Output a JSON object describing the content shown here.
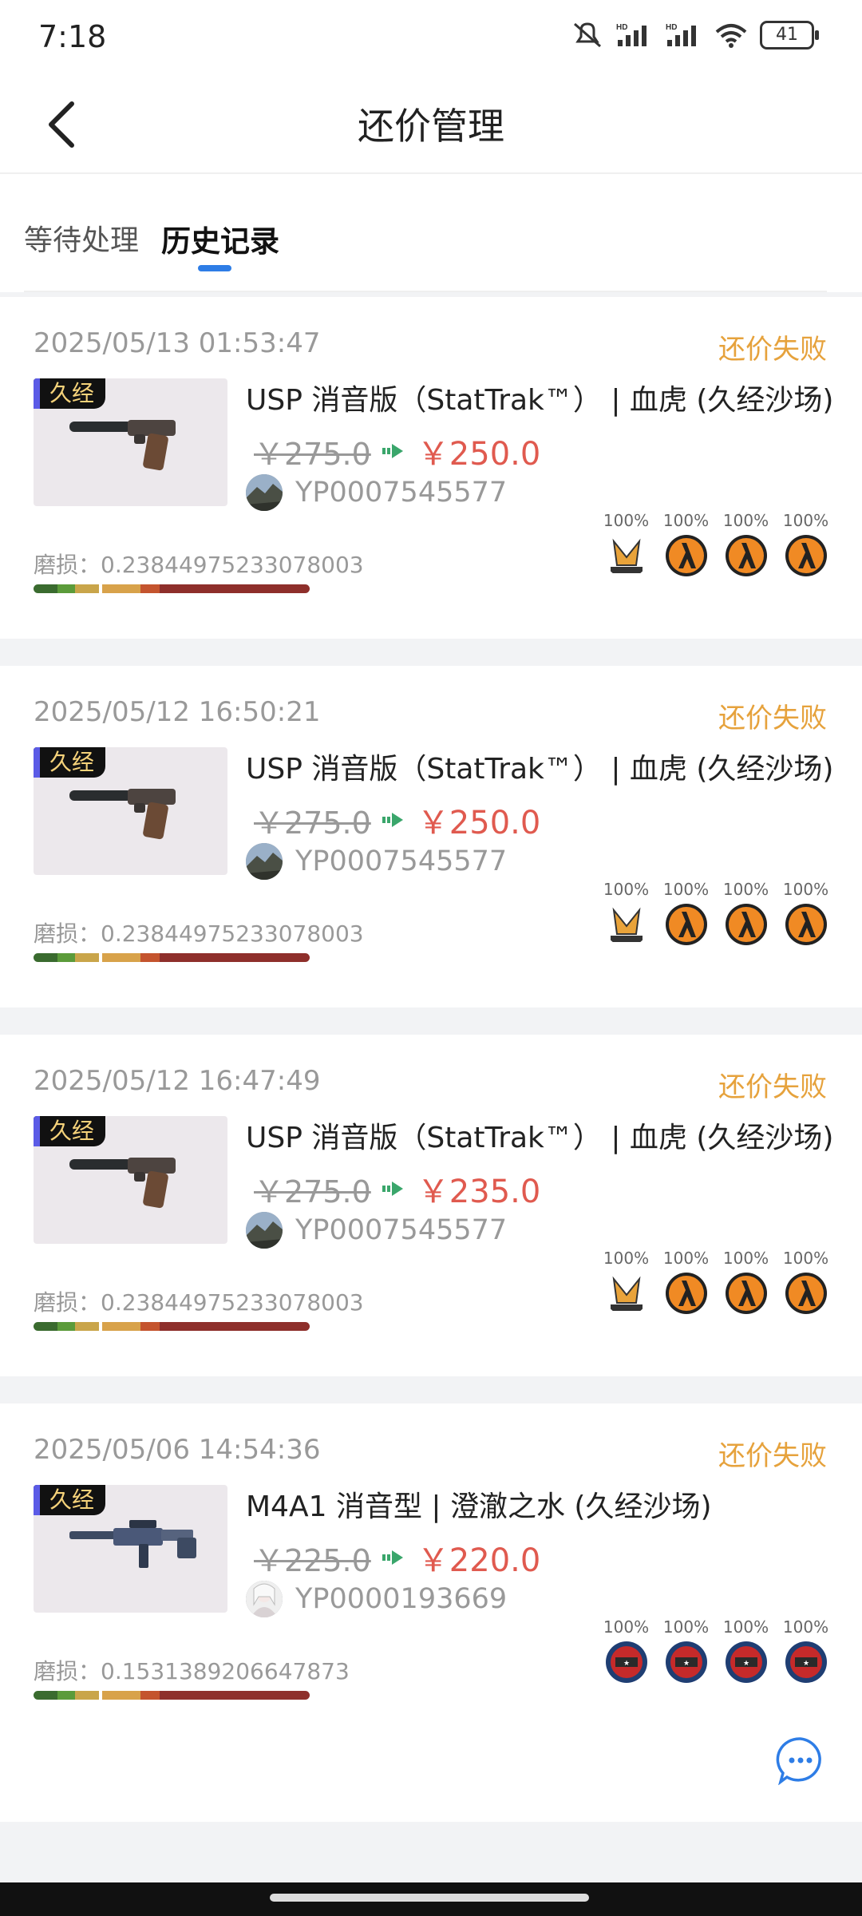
{
  "status_bar": {
    "time": "7:18",
    "battery": "41"
  },
  "header": {
    "title": "还价管理"
  },
  "tabs": [
    {
      "label": "等待处理"
    },
    {
      "label": "历史记录"
    }
  ],
  "wear_prefix": "磨损：",
  "records": [
    {
      "date": "2025/05/13 01:53:47",
      "status": "还价失败",
      "badge": "久经",
      "name": "USP 消音版（StatTrak™） | 血虎 (久经沙场)",
      "old_price": "￥275.0",
      "new_price": "￥250.0",
      "seller_id": "YP0007545577",
      "wear": "0.23844975233078003",
      "stickers": [
        "100%",
        "100%",
        "100%",
        "100%"
      ]
    },
    {
      "date": "2025/05/12 16:50:21",
      "status": "还价失败",
      "badge": "久经",
      "name": "USP 消音版（StatTrak™） | 血虎 (久经沙场)",
      "old_price": "￥275.0",
      "new_price": "￥250.0",
      "seller_id": "YP0007545577",
      "wear": "0.23844975233078003",
      "stickers": [
        "100%",
        "100%",
        "100%",
        "100%"
      ]
    },
    {
      "date": "2025/05/12 16:47:49",
      "status": "还价失败",
      "badge": "久经",
      "name": "USP 消音版（StatTrak™） | 血虎 (久经沙场)",
      "old_price": "￥275.0",
      "new_price": "￥235.0",
      "seller_id": "YP0007545577",
      "wear": "0.23844975233078003",
      "stickers": [
        "100%",
        "100%",
        "100%",
        "100%"
      ]
    },
    {
      "date": "2025/05/06 14:54:36",
      "status": "还价失败",
      "badge": "久经",
      "name": "M4A1 消音型 | 澄澈之水 (久经沙场)",
      "old_price": "￥225.0",
      "new_price": "￥220.0",
      "seller_id": "YP0000193669",
      "wear": "0.1531389206647873",
      "stickers": [
        "100%",
        "100%",
        "100%",
        "100%"
      ]
    }
  ],
  "colors": {
    "accent": "#2e7de6",
    "status_failed": "#e6a23c",
    "price_new": "#e05a4f"
  },
  "icons": {
    "chat": "chat-bubble-icon",
    "back": "back-arrow-icon"
  }
}
